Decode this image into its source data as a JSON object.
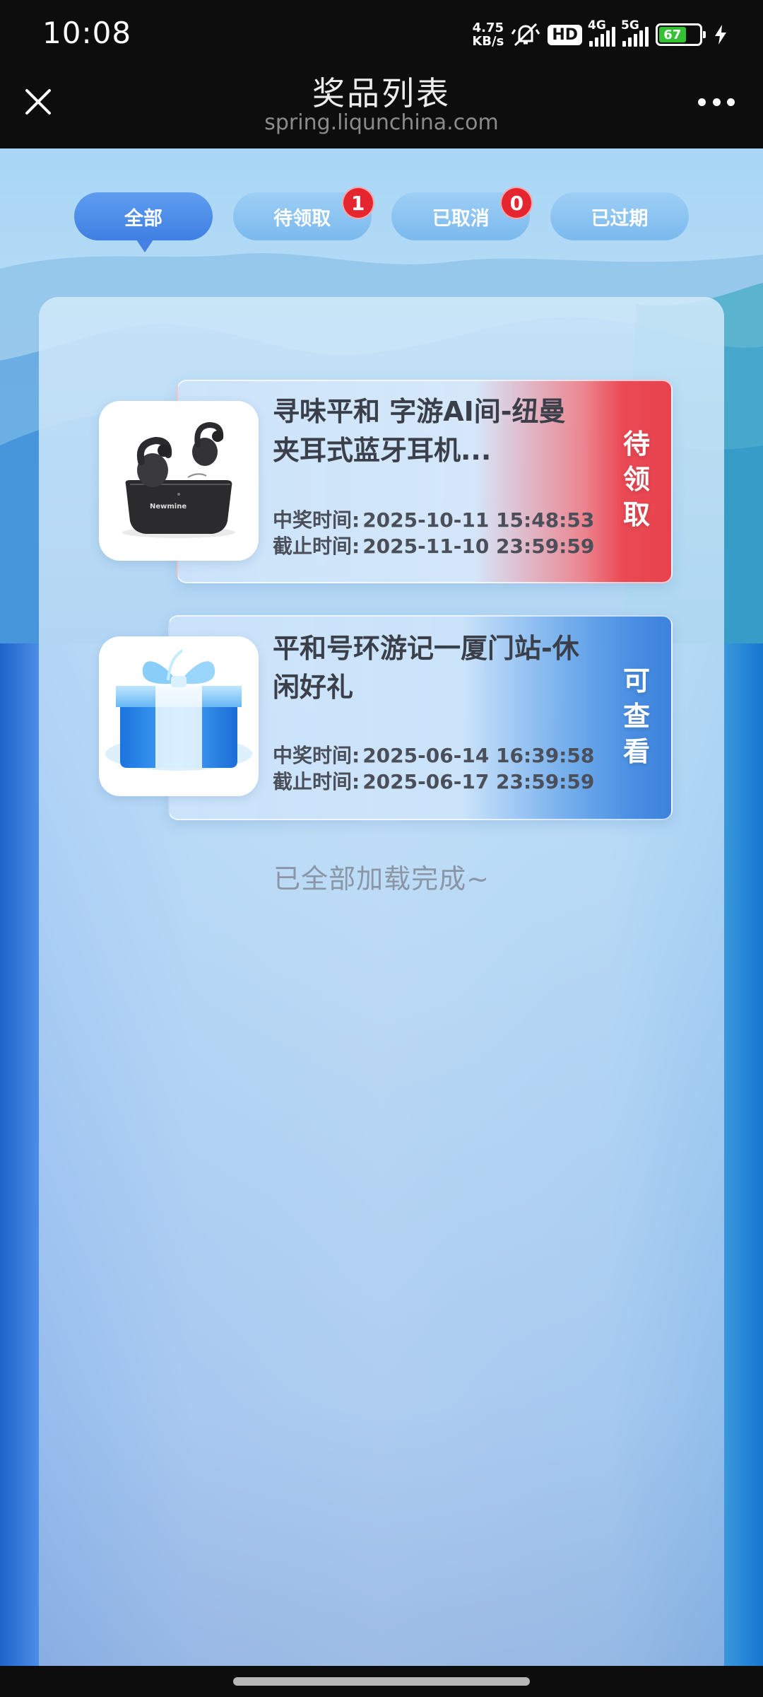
{
  "status_bar": {
    "time": "10:08",
    "net_speed_value": "4.75",
    "net_speed_unit": "KB/s",
    "hd_label": "HD",
    "signal_1_label": "4G",
    "signal_2_label": "5G",
    "battery": "67",
    "icons": [
      "mute-vibrate-icon",
      "signal-icon",
      "battery-icon",
      "charging-icon"
    ]
  },
  "nav": {
    "title": "奖品列表",
    "subtitle": "spring.liqunchina.com",
    "close_icon": "close-icon",
    "more_icon": "more-icon"
  },
  "tabs": [
    {
      "label": "全部",
      "active": true
    },
    {
      "label": "待领取",
      "badge": "1"
    },
    {
      "label": "已取消",
      "badge": "0"
    },
    {
      "label": "已过期"
    }
  ],
  "prizes": [
    {
      "title": "寻味平和 字游AI间-纽曼夹耳式蓝牙耳机...",
      "win_label": "中奖时间:",
      "win_time": "2025-10-11 15:48:53",
      "deadline_label": "截止时间:",
      "deadline_time": "2025-11-10 23:59:59",
      "status": "待领取",
      "status_color": "#e8424d",
      "image": "earbuds-image",
      "image_text": "Newmine"
    },
    {
      "title": "平和号环游记一厦门站-休闲好礼",
      "win_label": "中奖时间:",
      "win_time": "2025-06-14 16:39:58",
      "deadline_label": "截止时间:",
      "deadline_time": "2025-06-17 23:59:59",
      "status": "可查看",
      "status_color": "#3d82dc",
      "image": "gift-box-image"
    }
  ],
  "footer_text": "已全部加载完成~"
}
